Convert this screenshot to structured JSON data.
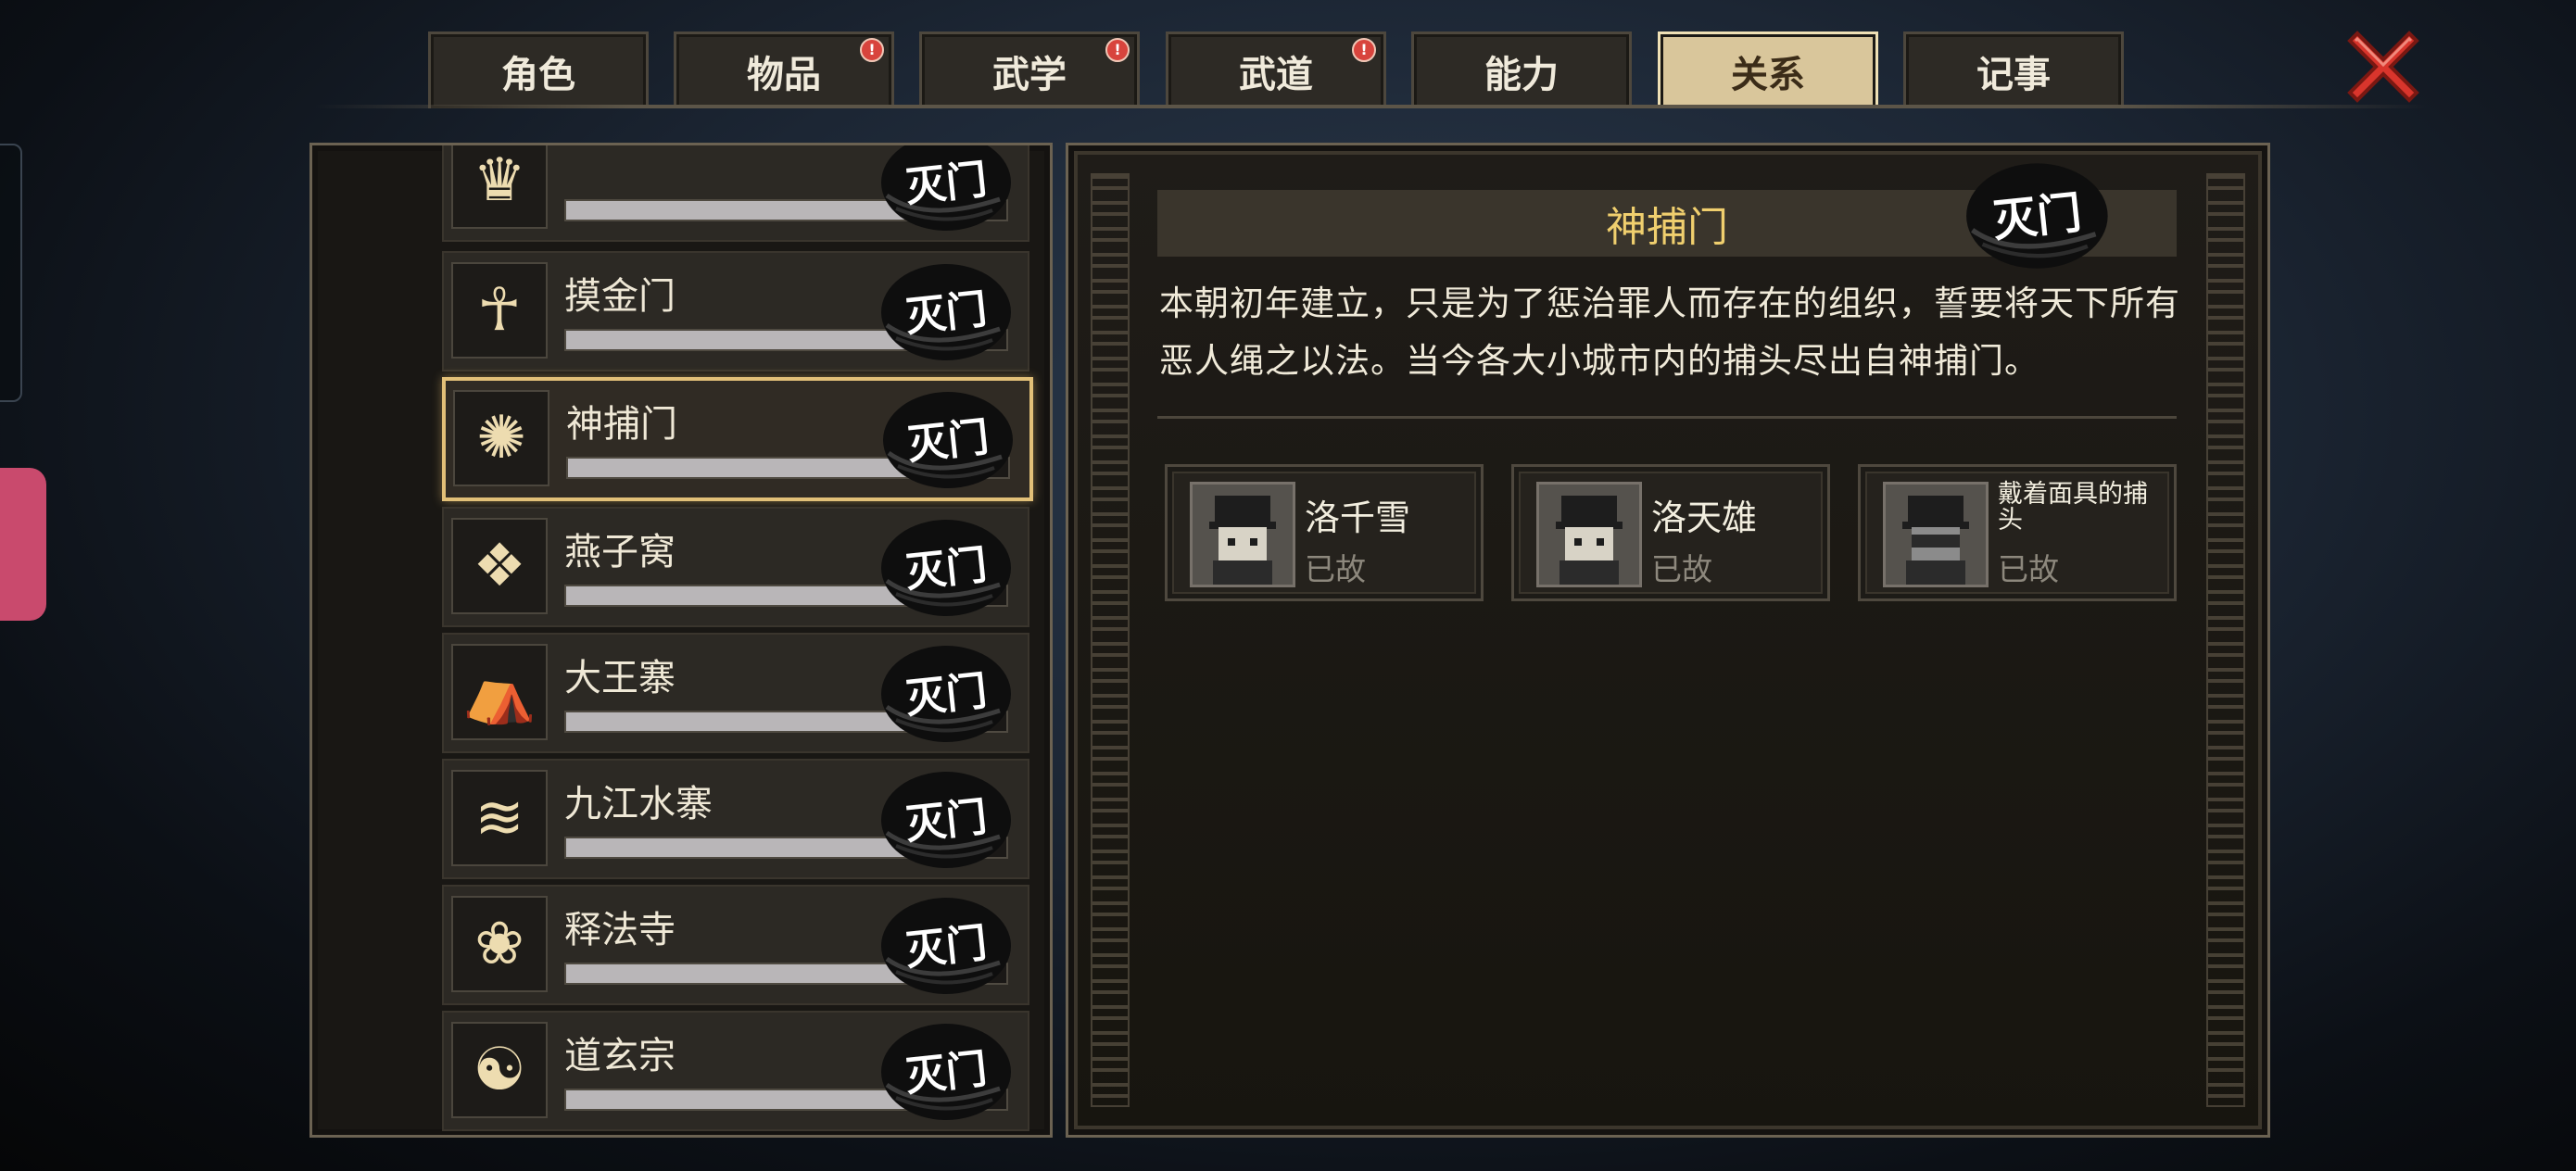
{
  "tabs": [
    {
      "label": "角色",
      "alert": false,
      "active": false
    },
    {
      "label": "物品",
      "alert": true,
      "active": false
    },
    {
      "label": "武学",
      "alert": true,
      "active": false
    },
    {
      "label": "武道",
      "alert": true,
      "active": false
    },
    {
      "label": "能力",
      "alert": false,
      "active": false
    },
    {
      "label": "关系",
      "alert": false,
      "active": true
    },
    {
      "label": "记事",
      "alert": false,
      "active": false
    }
  ],
  "alert_glyph": "!",
  "sects": [
    {
      "name": "",
      "emblem": "crown-emblem-icon",
      "progress": 0.84
    },
    {
      "name": "摸金门",
      "emblem": "scarab-emblem-icon",
      "progress": 0.84
    },
    {
      "name": "神捕门",
      "emblem": "eye-emblem-icon",
      "progress": 0.84,
      "selected": true
    },
    {
      "name": "燕子窝",
      "emblem": "swallow-emblem-icon",
      "progress": 0.84
    },
    {
      "name": "大王寨",
      "emblem": "fortress-emblem-icon",
      "progress": 0.84
    },
    {
      "name": "九江水寨",
      "emblem": "water-fort-emblem-icon",
      "progress": 0.84
    },
    {
      "name": "释法寺",
      "emblem": "lotus-emblem-icon",
      "progress": 0.84
    },
    {
      "name": "道玄宗",
      "emblem": "crane-emblem-icon",
      "progress": 0.84
    }
  ],
  "seal_text": "灭门",
  "detail": {
    "title": "神捕门",
    "description": "本朝初年建立，只是为了惩治罪人而存在的组织，誓要将天下所有恶人绳之以法。当今各大小城市内的捕头尽出自神捕门。",
    "members": [
      {
        "name": "洛千雪",
        "status": "已故"
      },
      {
        "name": "洛天雄",
        "status": "已故"
      },
      {
        "name": "戴着面具的捕头",
        "status": "已故"
      }
    ]
  },
  "colors": {
    "accent": "#f0cf6e",
    "tab_active": "#d9c69b",
    "alert": "#d8443d",
    "close": "#d9352c"
  }
}
